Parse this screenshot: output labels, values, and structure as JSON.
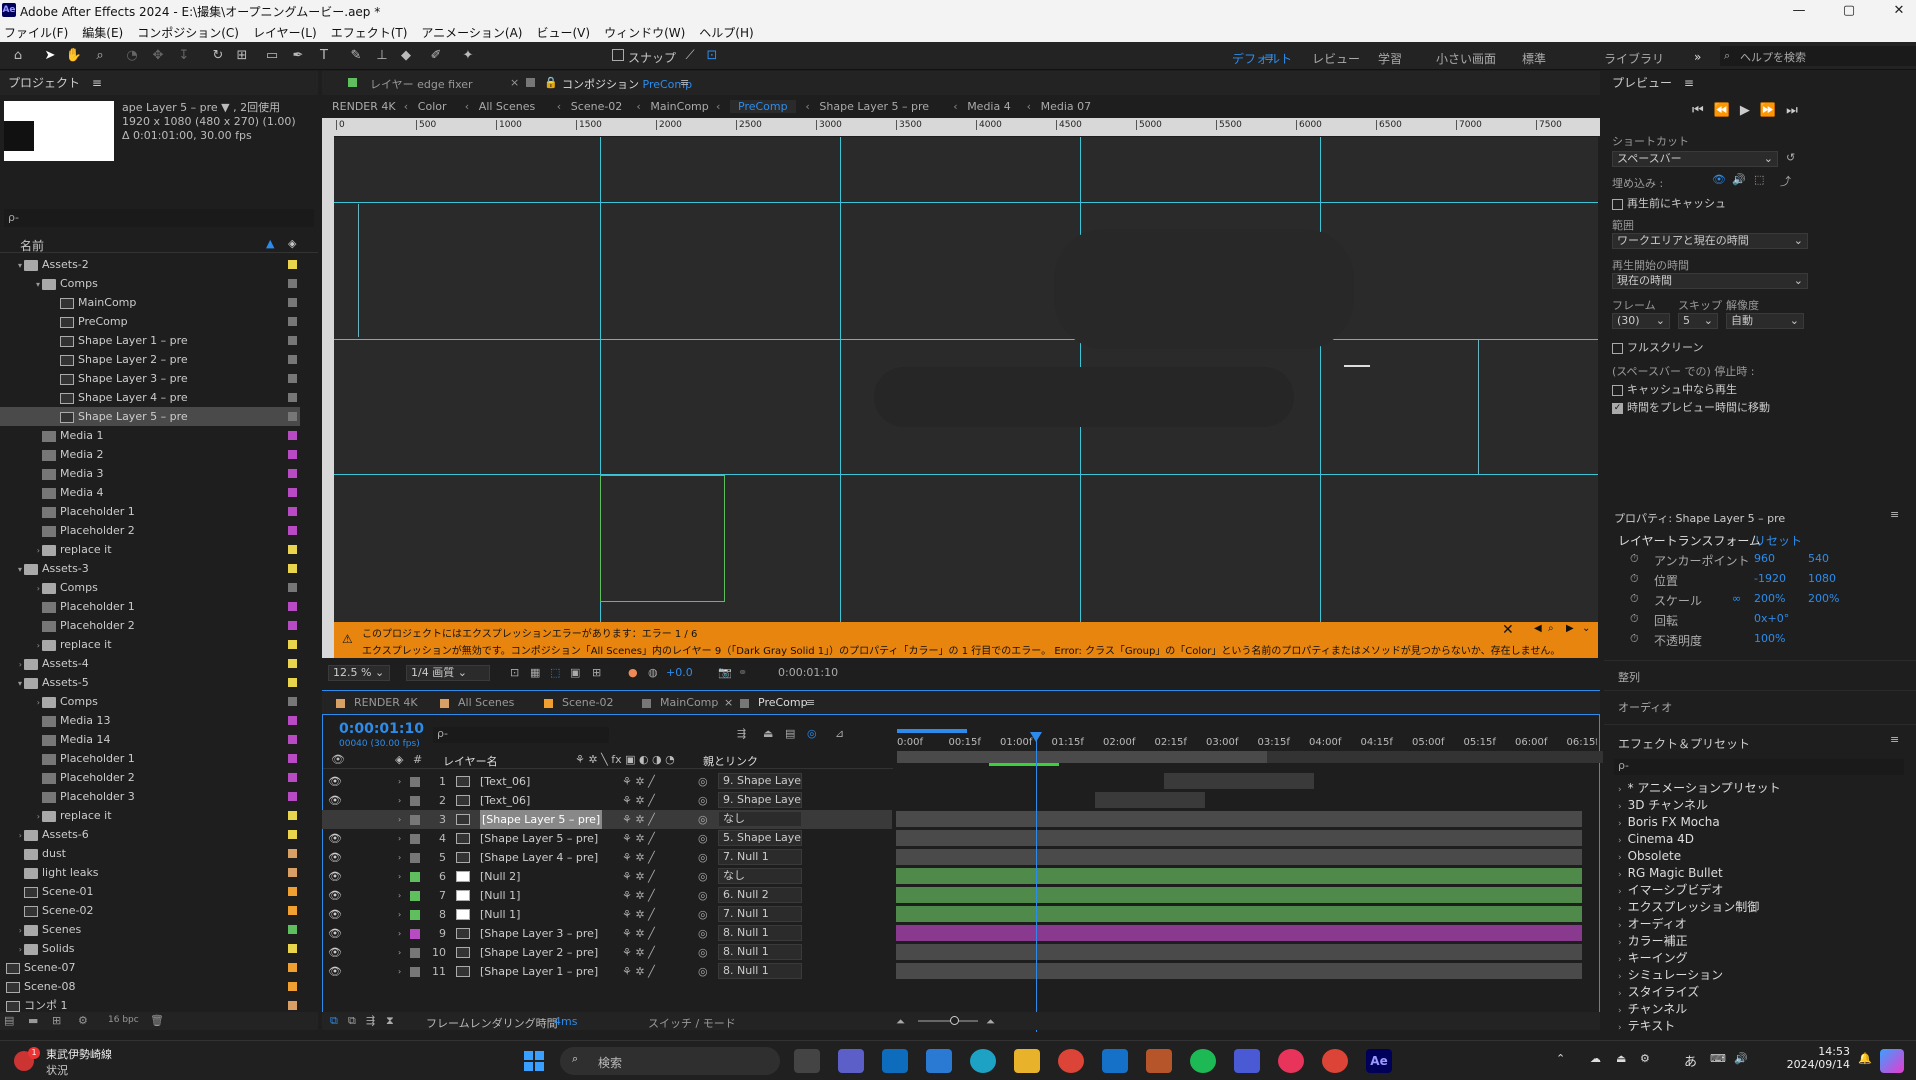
{
  "window": {
    "title": "Adobe After Effects 2024 - E:\\撮集\\オープニングムービー.aep *",
    "logo": "Ae",
    "min": "—",
    "max": "▢",
    "close": "✕"
  },
  "menu": [
    "ファイル(F)",
    "編集(E)",
    "コンポジション(C)",
    "レイヤー(L)",
    "エフェクト(T)",
    "アニメーション(A)",
    "ビュー(V)",
    "ウィンドウ(W)",
    "ヘルプ(H)"
  ],
  "toolbar": {
    "snap": "スナップ",
    "workspaces": [
      "デフォルト",
      "レビュー",
      "学習",
      "小さい画面",
      "標準",
      "ライブラリ"
    ],
    "more": "»",
    "search_placeholder": "ヘルプを検索"
  },
  "project": {
    "title": "プロジェクト",
    "info_line1": "ape Layer 5 – pre ▼ , 2回使用",
    "info_line2": "1920 x 1080 (480 x 270) (1.00)",
    "info_line3": "Δ 0:01:01:00, 30.00 fps",
    "search_placeholder": "ρ-",
    "col_name": "名前",
    "bpc": "16 bpc",
    "items": [
      {
        "name": "Assets-2",
        "type": "folder",
        "indent": 1,
        "tri": "▾",
        "color": "#e8d44d"
      },
      {
        "name": "Comps",
        "type": "folder",
        "indent": 2,
        "tri": "▾",
        "color": "#777777"
      },
      {
        "name": "MainComp",
        "type": "comp",
        "indent": 3,
        "tri": "",
        "color": "#777777"
      },
      {
        "name": "PreComp",
        "type": "comp",
        "indent": 3,
        "tri": "",
        "color": "#777777"
      },
      {
        "name": "Shape Layer 1 – pre",
        "type": "comp",
        "indent": 3,
        "tri": "",
        "color": "#777777"
      },
      {
        "name": "Shape Layer 2 – pre",
        "type": "comp",
        "indent": 3,
        "tri": "",
        "color": "#777777"
      },
      {
        "name": "Shape Layer 3 – pre",
        "type": "comp",
        "indent": 3,
        "tri": "",
        "color": "#777777"
      },
      {
        "name": "Shape Layer 4 – pre",
        "type": "comp",
        "indent": 3,
        "tri": "",
        "color": "#777777"
      },
      {
        "name": "Shape Layer 5 – pre",
        "type": "comp",
        "indent": 3,
        "tri": "",
        "color": "#777777",
        "selected": true
      },
      {
        "name": "Media 1",
        "type": "footage",
        "indent": 2,
        "tri": "",
        "color": "#b84bc4"
      },
      {
        "name": "Media 2",
        "type": "footage",
        "indent": 2,
        "tri": "",
        "color": "#b84bc4"
      },
      {
        "name": "Media 3",
        "type": "footage",
        "indent": 2,
        "tri": "",
        "color": "#b84bc4"
      },
      {
        "name": "Media 4",
        "type": "footage",
        "indent": 2,
        "tri": "",
        "color": "#b84bc4"
      },
      {
        "name": "Placeholder 1",
        "type": "footage",
        "indent": 2,
        "tri": "",
        "color": "#b84bc4"
      },
      {
        "name": "Placeholder 2",
        "type": "footage",
        "indent": 2,
        "tri": "",
        "color": "#b84bc4"
      },
      {
        "name": "replace it",
        "type": "folder",
        "indent": 2,
        "tri": "›",
        "color": "#e8d44d"
      },
      {
        "name": "Assets-3",
        "type": "folder",
        "indent": 1,
        "tri": "▾",
        "color": "#e8d44d"
      },
      {
        "name": "Comps",
        "type": "folder",
        "indent": 2,
        "tri": "›",
        "color": "#777777"
      },
      {
        "name": "Placeholder 1",
        "type": "footage",
        "indent": 2,
        "tri": "",
        "color": "#b84bc4"
      },
      {
        "name": "Placeholder 2",
        "type": "footage",
        "indent": 2,
        "tri": "",
        "color": "#b84bc4"
      },
      {
        "name": "replace it",
        "type": "folder",
        "indent": 2,
        "tri": "›",
        "color": "#e8d44d"
      },
      {
        "name": "Assets-4",
        "type": "folder",
        "indent": 1,
        "tri": "›",
        "color": "#e8d44d"
      },
      {
        "name": "Assets-5",
        "type": "folder",
        "indent": 1,
        "tri": "▾",
        "color": "#e8d44d"
      },
      {
        "name": "Comps",
        "type": "folder",
        "indent": 2,
        "tri": "›",
        "color": "#777777"
      },
      {
        "name": "Media 13",
        "type": "footage",
        "indent": 2,
        "tri": "",
        "color": "#b84bc4"
      },
      {
        "name": "Media 14",
        "type": "footage",
        "indent": 2,
        "tri": "",
        "color": "#b84bc4"
      },
      {
        "name": "Placeholder 1",
        "type": "footage",
        "indent": 2,
        "tri": "",
        "color": "#b84bc4"
      },
      {
        "name": "Placeholder 2",
        "type": "footage",
        "indent": 2,
        "tri": "",
        "color": "#b84bc4"
      },
      {
        "name": "Placeholder 3",
        "type": "footage",
        "indent": 2,
        "tri": "",
        "color": "#b84bc4"
      },
      {
        "name": "replace it",
        "type": "folder",
        "indent": 2,
        "tri": "›",
        "color": "#e8d44d"
      },
      {
        "name": "Assets-6",
        "type": "folder",
        "indent": 1,
        "tri": "›",
        "color": "#e8d44d"
      },
      {
        "name": "dust",
        "type": "folder",
        "indent": 1,
        "tri": "",
        "color": "#d9a066"
      },
      {
        "name": "light leaks",
        "type": "folder",
        "indent": 1,
        "tri": "",
        "color": "#d9a066"
      },
      {
        "name": "Scene-01",
        "type": "comp",
        "indent": 1,
        "tri": "",
        "color": "#f0a030"
      },
      {
        "name": "Scene-02",
        "type": "comp",
        "indent": 1,
        "tri": "",
        "color": "#f0a030"
      },
      {
        "name": "Scenes",
        "type": "folder",
        "indent": 1,
        "tri": "›",
        "color": "#5fbf5f"
      },
      {
        "name": "Solids",
        "type": "folder",
        "indent": 1,
        "tri": "›",
        "color": "#e8d44d"
      },
      {
        "name": "Scene-07",
        "type": "comp",
        "indent": 0,
        "tri": "",
        "color": "#f0a030"
      },
      {
        "name": "Scene-08",
        "type": "comp",
        "indent": 0,
        "tri": "",
        "color": "#f0a030"
      },
      {
        "name": "コンポ 1",
        "type": "comp",
        "indent": 0,
        "tri": "",
        "color": "#d9a066"
      }
    ]
  },
  "viewer": {
    "tab_prev": "レイヤー edge fixer",
    "tab_comp_prefix": "コンポジション",
    "tab_comp_name": "PreComp",
    "breadcrumbs": [
      "RENDER 4K",
      "Color",
      "All Scenes",
      "Scene-02",
      "MainComp",
      "PreComp",
      "Shape Layer 5 – pre",
      "Media 4",
      "Media 07"
    ],
    "ruler": [
      "0",
      "500",
      "1000",
      "1500",
      "2000",
      "2500",
      "3000",
      "3500",
      "4000",
      "4500",
      "5000",
      "5500",
      "6000",
      "6500",
      "7000",
      "7500"
    ],
    "zoom": "12.5 %",
    "resolution": "1/4 画質",
    "exposure": "+0.0",
    "timecode": "0:00:01:10",
    "error_line1": "このプロジェクトにはエクスプレッションエラーがあります：エラー 1 / 6",
    "error_line2": "エクスプレッションが無効です。コンポジション「All Scenes」内のレイヤー 9（「Dark Gray Solid 1」）のプロパティ「カラー」の 1 行目でのエラー。 Error: クラス「Group」の「Color」という名前のプロパティまたはメソッドが見つからないか、存在しません。 名前が変更されたか、移動または削除されたか、あい"
  },
  "timeline": {
    "tabs": [
      {
        "label": "RENDER 4K",
        "color": "#d9a066"
      },
      {
        "label": "All Scenes",
        "color": "#d9a066"
      },
      {
        "label": "Scene-02",
        "color": "#f0a030"
      },
      {
        "label": "MainComp",
        "color": "#777777"
      },
      {
        "label": "PreComp",
        "color": "#777777"
      }
    ],
    "timecode": "0:00:01:10",
    "fps": "00040 (30.00 fps)",
    "col_layer": "レイヤー名",
    "col_parent": "親とリンク",
    "col_num": "#",
    "ticks": [
      "0:00f",
      "00:15f",
      "01:00f",
      "01:15f",
      "02:00f",
      "02:15f",
      "03:00f",
      "03:15f",
      "04:00f",
      "04:15f",
      "05:00f",
      "05:15f",
      "06:00f",
      "06:15f"
    ],
    "render_time_label": "フレームレンダリング時間",
    "render_time": "4ms",
    "switch_mode": "スイッチ / モード",
    "layers": [
      {
        "num": "1",
        "name": "[Text_06]",
        "label": "#777777",
        "parent": "9. Shape Laye",
        "bar": "#3a3a3a",
        "bar_start": 0.39,
        "bar_end": 0.61
      },
      {
        "num": "2",
        "name": "[Text_06]",
        "label": "#777777",
        "parent": "9. Shape Laye",
        "bar": "#3a3a3a",
        "bar_start": 0.29,
        "bar_end": 0.45
      },
      {
        "num": "3",
        "name": "[Shape Layer 5 – pre]",
        "label": "#777777",
        "parent": "なし",
        "bar": "#4a4a4a",
        "bar_start": 0,
        "bar_end": 1,
        "selected": true
      },
      {
        "num": "4",
        "name": "[Shape Layer 5 – pre]",
        "label": "#777777",
        "parent": "5. Shape Laye",
        "bar": "#4a4a4a",
        "bar_start": 0,
        "bar_end": 1
      },
      {
        "num": "5",
        "name": "[Shape Layer 4 – pre]",
        "label": "#777777",
        "parent": "7. Null 1",
        "bar": "#4a4a4a",
        "bar_start": 0,
        "bar_end": 1
      },
      {
        "num": "6",
        "name": "[Null 2]",
        "label": "#5fbf5f",
        "parent": "なし",
        "bar": "#4f8a4a",
        "bar_start": 0,
        "bar_end": 1
      },
      {
        "num": "7",
        "name": "[Null 1]",
        "label": "#5fbf5f",
        "parent": "6. Null 2",
        "bar": "#4f8a4a",
        "bar_start": 0,
        "bar_end": 1
      },
      {
        "num": "8",
        "name": "[Null 1]",
        "label": "#5fbf5f",
        "parent": "7. Null 1",
        "bar": "#4f8a4a",
        "bar_start": 0,
        "bar_end": 1
      },
      {
        "num": "9",
        "name": "[Shape Layer 3 – pre]",
        "label": "#b84bc4",
        "parent": "8. Null 1",
        "bar": "#8a3a8e",
        "bar_start": 0,
        "bar_end": 1
      },
      {
        "num": "10",
        "name": "[Shape Layer 2 – pre]",
        "label": "#777777",
        "parent": "8. Null 1",
        "bar": "#4a4a4a",
        "bar_start": 0,
        "bar_end": 1
      },
      {
        "num": "11",
        "name": "[Shape Layer 1 – pre]",
        "label": "#777777",
        "parent": "8. Null 1",
        "bar": "#4a4a4a",
        "bar_start": 0,
        "bar_end": 1
      }
    ]
  },
  "preview": {
    "title": "プレビュー",
    "shortcut_label": "ショートカット",
    "shortcut_value": "スペースバー",
    "embed_label": "埋め込み :",
    "cache_before": "再生前にキャッシュ",
    "range_label": "範囲",
    "range_value": "ワークエリアと現在の時間",
    "start_label": "再生開始の時間",
    "start_value": "現在の時間",
    "frame_label": "フレーム",
    "skip_label": "スキップ",
    "res_label": "解像度",
    "frame_value": "(30)",
    "skip_value": "5",
    "res_value": "自動",
    "fullscreen": "フルスクリーン",
    "stop_label": "(スペースバー での) 停止時 :",
    "stop_opt1": "キャッシュ中なら再生",
    "stop_opt2": "時間をプレビュー時間に移動",
    "stop_opt2_checked": true
  },
  "properties": {
    "title": "プロパティ: Shape Layer 5 – pre",
    "group": "レイヤートランスフォーム",
    "reset": "リセット",
    "rows": [
      {
        "label": "アンカーポイント",
        "v1": "960",
        "v2": "540"
      },
      {
        "label": "位置",
        "v1": "-1920",
        "v2": "1080"
      },
      {
        "label": "スケール",
        "v1": "200%",
        "v2": "200%"
      },
      {
        "label": "回転",
        "v1": "0x+0°",
        "v2": ""
      },
      {
        "label": "不透明度",
        "v1": "100%",
        "v2": ""
      }
    ]
  },
  "align_label": "整列",
  "audio_label": "オーディオ",
  "effects": {
    "title": "エフェクト＆プリセット",
    "search_placeholder": "ρ-",
    "items": [
      "* アニメーションプリセット",
      "3D チャンネル",
      "Boris FX Mocha",
      "Cinema 4D",
      "Obsolete",
      "RG Magic Bullet",
      "イマーシブビデオ",
      "エクスプレッション制御",
      "オーディオ",
      "カラー補正",
      "キーイング",
      "シミュレーション",
      "スタイライズ",
      "チャンネル",
      "テキスト"
    ]
  },
  "taskbar": {
    "weather_title": "東武伊勢崎線",
    "weather_sub": "状況",
    "search": "検索",
    "time": "14:53",
    "date": "2024/09/14",
    "ime": "あ",
    "badge": "1"
  }
}
